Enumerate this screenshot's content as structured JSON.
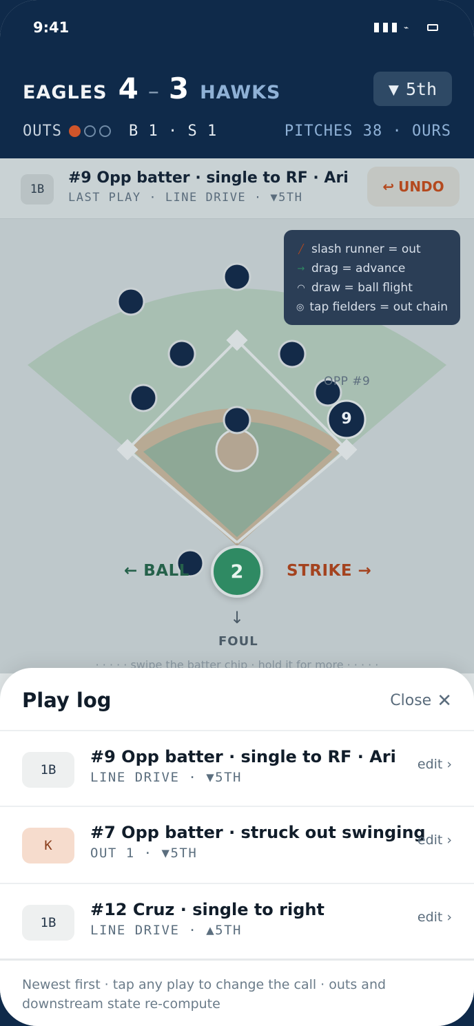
{
  "status_bar": {
    "time": "9:41"
  },
  "scoreboard": {
    "home_team": "EAGLES",
    "home_score": "4",
    "dash": "–",
    "away_score": "3",
    "away_team": "HAWKS",
    "inning_arrow": "▼",
    "inning": "5th",
    "outs_label": "OUTS",
    "outs": 1,
    "balls_strikes": "B 1 · S 1",
    "pitches": "PITCHES 38 · OURS"
  },
  "last_play": {
    "badge": "1B",
    "title": "#9 Opp batter · single to RF · Ari",
    "subtitle": "LAST PLAY · LINE DRIVE · ▼5TH",
    "undo_icon": "↩",
    "undo_label": "UNDO"
  },
  "legend": [
    {
      "icon": "slash-icon",
      "glyph": "╱",
      "color": "#b4491e",
      "text": "slash runner = out"
    },
    {
      "icon": "drag-arrow-icon",
      "glyph": "→",
      "color": "#2f8a63",
      "text": "drag = advance"
    },
    {
      "icon": "arc-icon",
      "glyph": "◠",
      "color": "#d8e0ea",
      "text": "draw = ball flight"
    },
    {
      "icon": "target-icon",
      "glyph": "◎",
      "color": "#d8e0ea",
      "text": "tap fielders = out chain"
    }
  ],
  "field": {
    "runner_label": "OPP #9",
    "runner_number": "9",
    "ball_label": "← BALL",
    "strike_label": "STRIKE →",
    "batter_number": "2",
    "foul_arrow": "↓",
    "foul_label": "FOUL",
    "hint": "· · · · ·  swipe the batter chip · hold it for more  · · · · ·"
  },
  "play_log": {
    "title": "Play log",
    "close_label": "Close",
    "close_icon": "✕",
    "entries": [
      {
        "badge": "1B",
        "type": "hit",
        "title": "#9 Opp batter · single to RF · Ari",
        "subtitle": "LINE DRIVE · ▼5TH",
        "edit": "edit ›"
      },
      {
        "badge": "K",
        "type": "out",
        "title": "#7 Opp batter · struck out swinging",
        "subtitle": "OUT 1 · ▼5TH",
        "edit": "edit ›"
      },
      {
        "badge": "1B",
        "type": "hit",
        "title": "#12 Cruz · single to right",
        "subtitle": "LINE DRIVE · ▲5TH",
        "edit": "edit ›"
      }
    ],
    "footnote": "Newest first · tap any play to change the call · outs and downstream state re-compute"
  },
  "colors": {
    "navy": "#0f2a4a",
    "accent_orange": "#d0552a",
    "batter_green": "#2f8a63",
    "grass": "#9fb9ab",
    "dirt": "#b3a592"
  }
}
